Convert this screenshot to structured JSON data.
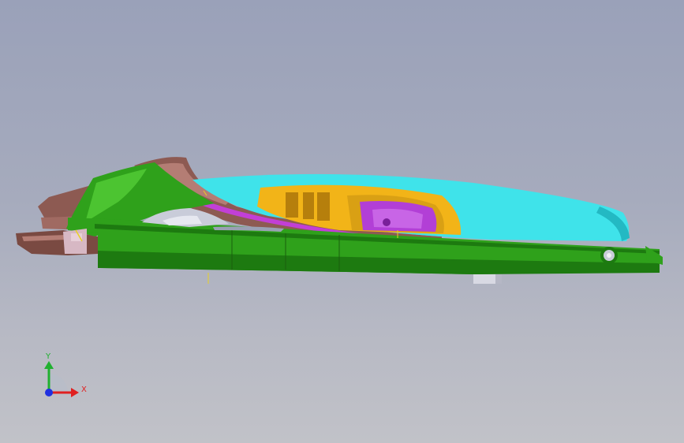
{
  "viewport": {
    "background_top": "#9aa1b9",
    "background_bottom": "#c1c2c8"
  },
  "model": {
    "part_colors": {
      "body": "#2fa11b",
      "body_light": "#4cc431",
      "body_dark": "#1d7a10",
      "cover": "#3fe3ea",
      "cover_dark": "#23b9c3",
      "bracket": "#f2b418",
      "bracket_dark": "#b67f0c",
      "lens": "#b23fd6",
      "lens_dark": "#7a1f9a",
      "shell": "#8d5a52",
      "shell_light": "#b47d74",
      "heatsink": "#c9ccd9",
      "clip": "#d7b8c4"
    }
  },
  "triad": {
    "x_label": "X",
    "y_label": "Y",
    "x_color": "#e02020",
    "y_color": "#20b030",
    "z_color": "#2030e0"
  }
}
